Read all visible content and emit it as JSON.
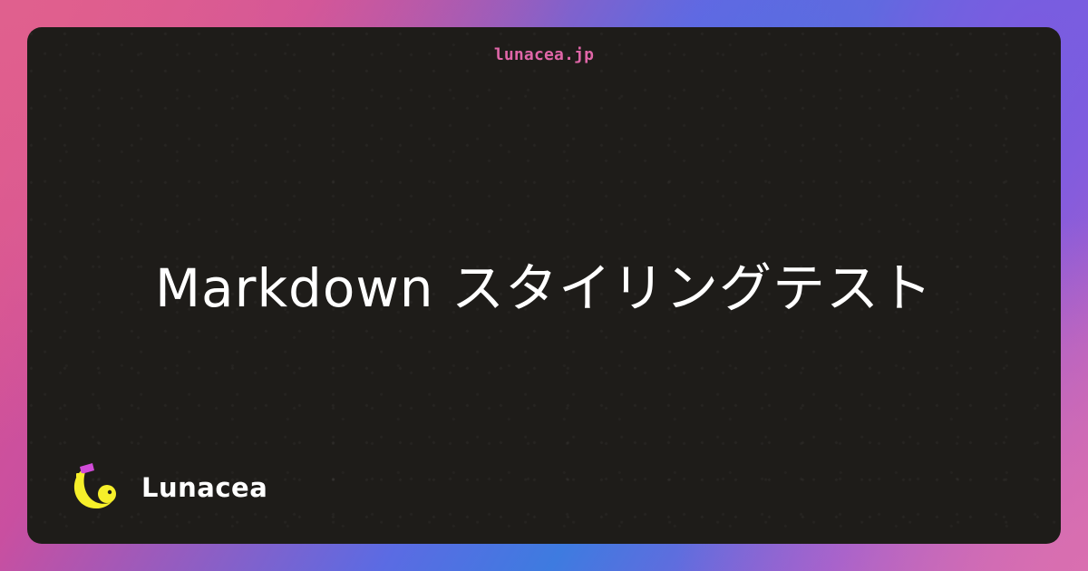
{
  "header": {
    "site_url": "lunacea.jp"
  },
  "main": {
    "title": "Markdown スタイリングテスト"
  },
  "footer": {
    "brand_name": "Lunacea",
    "logo_icon": "crescent-moon-logo-icon"
  },
  "colors": {
    "card_background": "#1e1c19",
    "site_url": "#e066a8",
    "title": "#ffffff",
    "logo_moon": "#f6ef2a",
    "logo_accent": "#d14bd8"
  }
}
